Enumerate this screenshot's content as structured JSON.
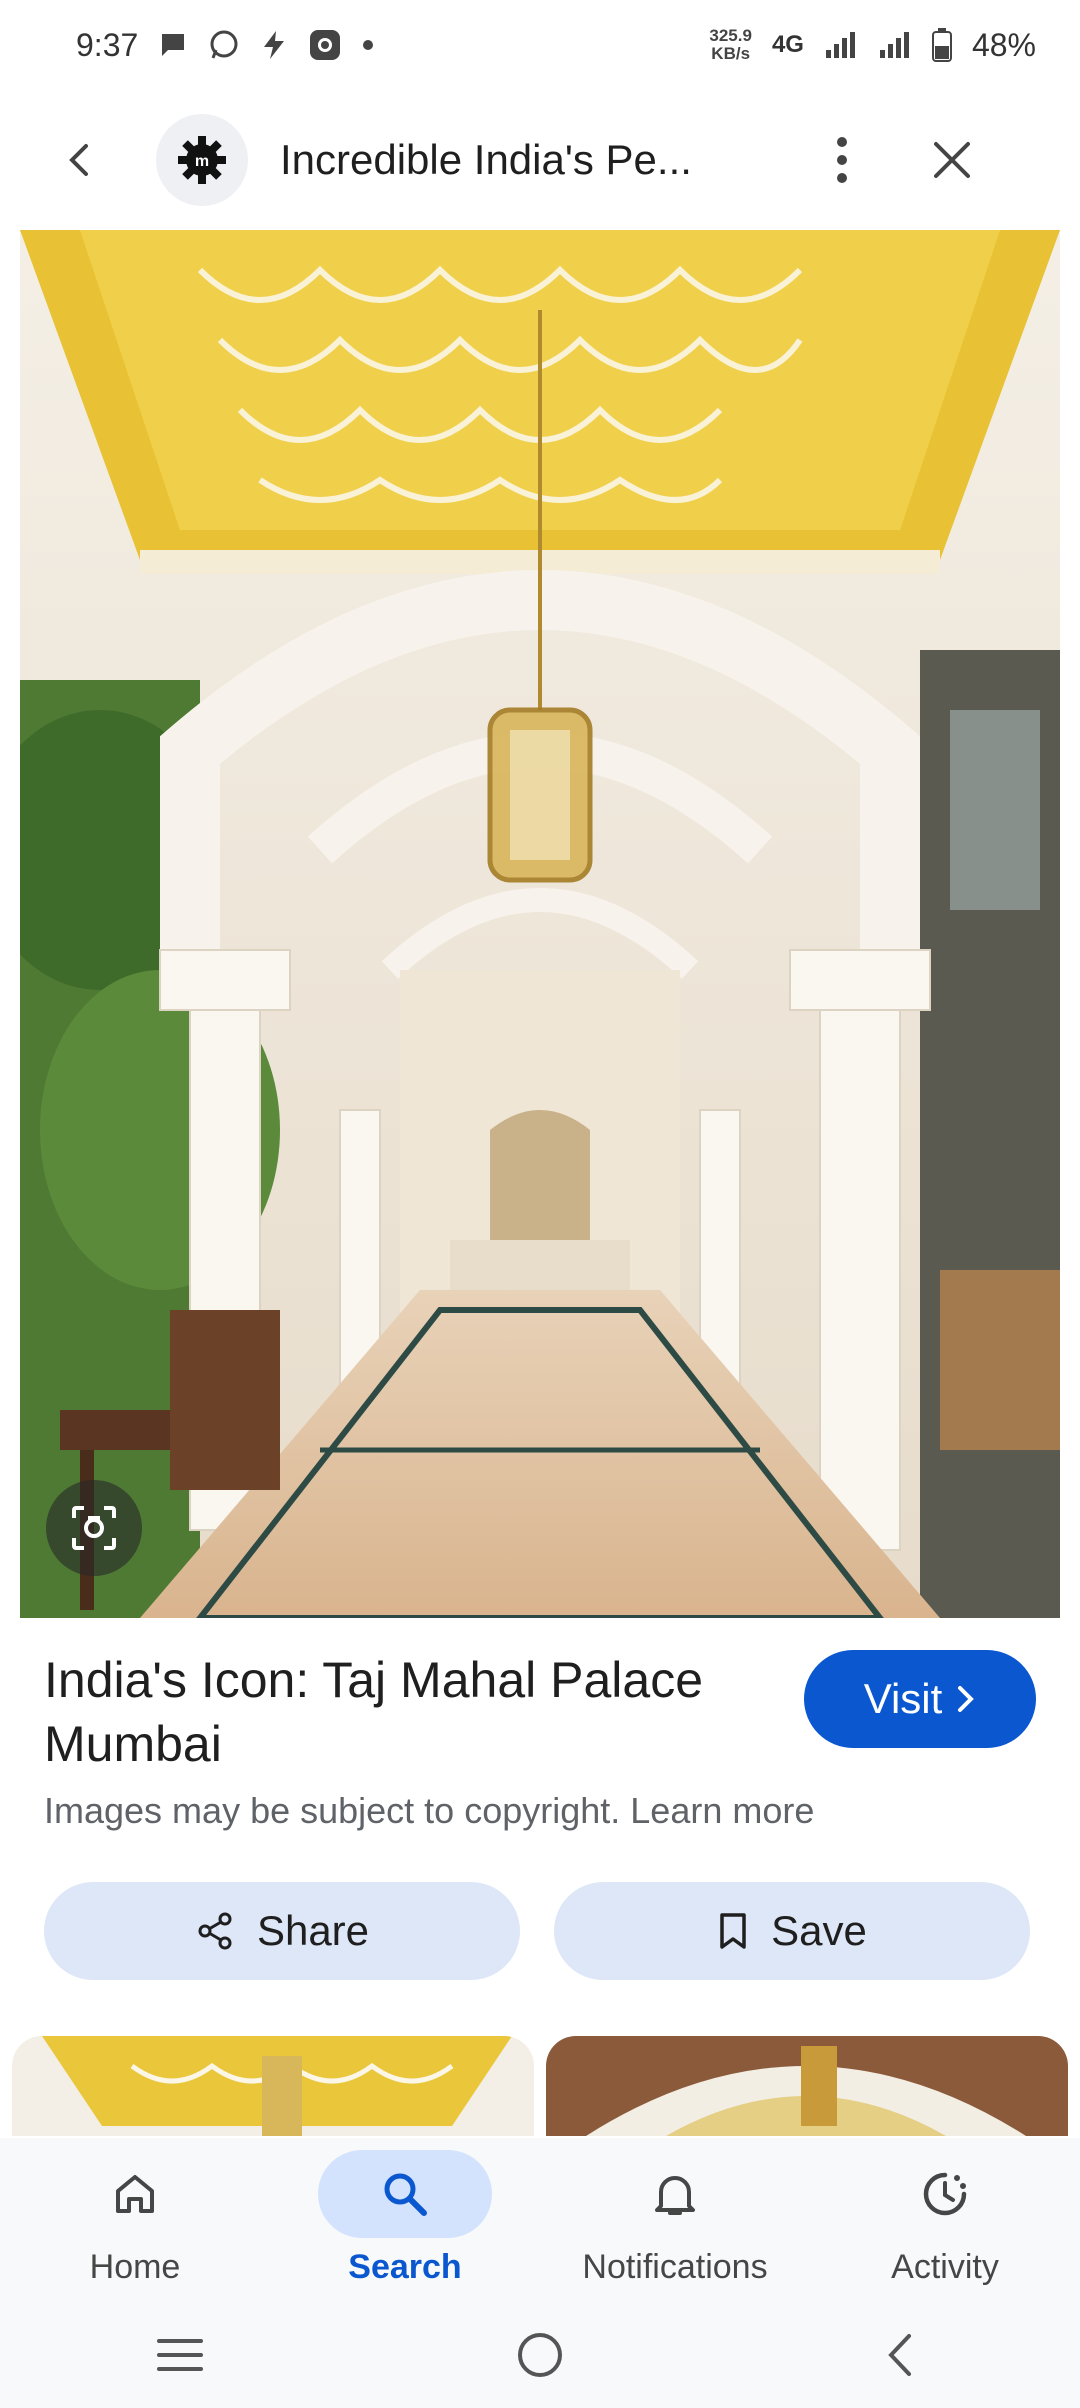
{
  "status_bar": {
    "time": "9:37",
    "network_speed_value": "325.9",
    "network_speed_unit": "KB/s",
    "network_type": "4G",
    "battery": "48%",
    "icons": [
      "chat-icon",
      "whatsapp-icon",
      "messenger-icon",
      "camera-app-icon",
      "dot-icon",
      "signal-icon",
      "battery-icon"
    ]
  },
  "app_bar": {
    "title": "Incredible India's Pe...",
    "icons": [
      "back-arrow-icon",
      "site-logo-icon",
      "more-vert-icon",
      "close-icon"
    ]
  },
  "image": {
    "description_icon": "lens-icon"
  },
  "result": {
    "title": "India's Icon: Taj Mahal Palace Mumbai",
    "visit_label": "Visit",
    "copyright": "Images may be subject to copyright. Learn more"
  },
  "actions": {
    "share_label": "Share",
    "save_label": "Save"
  },
  "bottom_nav": {
    "items": [
      {
        "label": "Home",
        "icon": "home-icon",
        "active": false
      },
      {
        "label": "Search",
        "icon": "search-icon",
        "active": true
      },
      {
        "label": "Notifications",
        "icon": "bell-icon",
        "active": false
      },
      {
        "label": "Activity",
        "icon": "activity-icon",
        "active": false
      }
    ]
  },
  "colors": {
    "accent": "#0b57d0",
    "chip_bg": "#dde7f7",
    "nav_active_bg": "#d3e3fd"
  }
}
